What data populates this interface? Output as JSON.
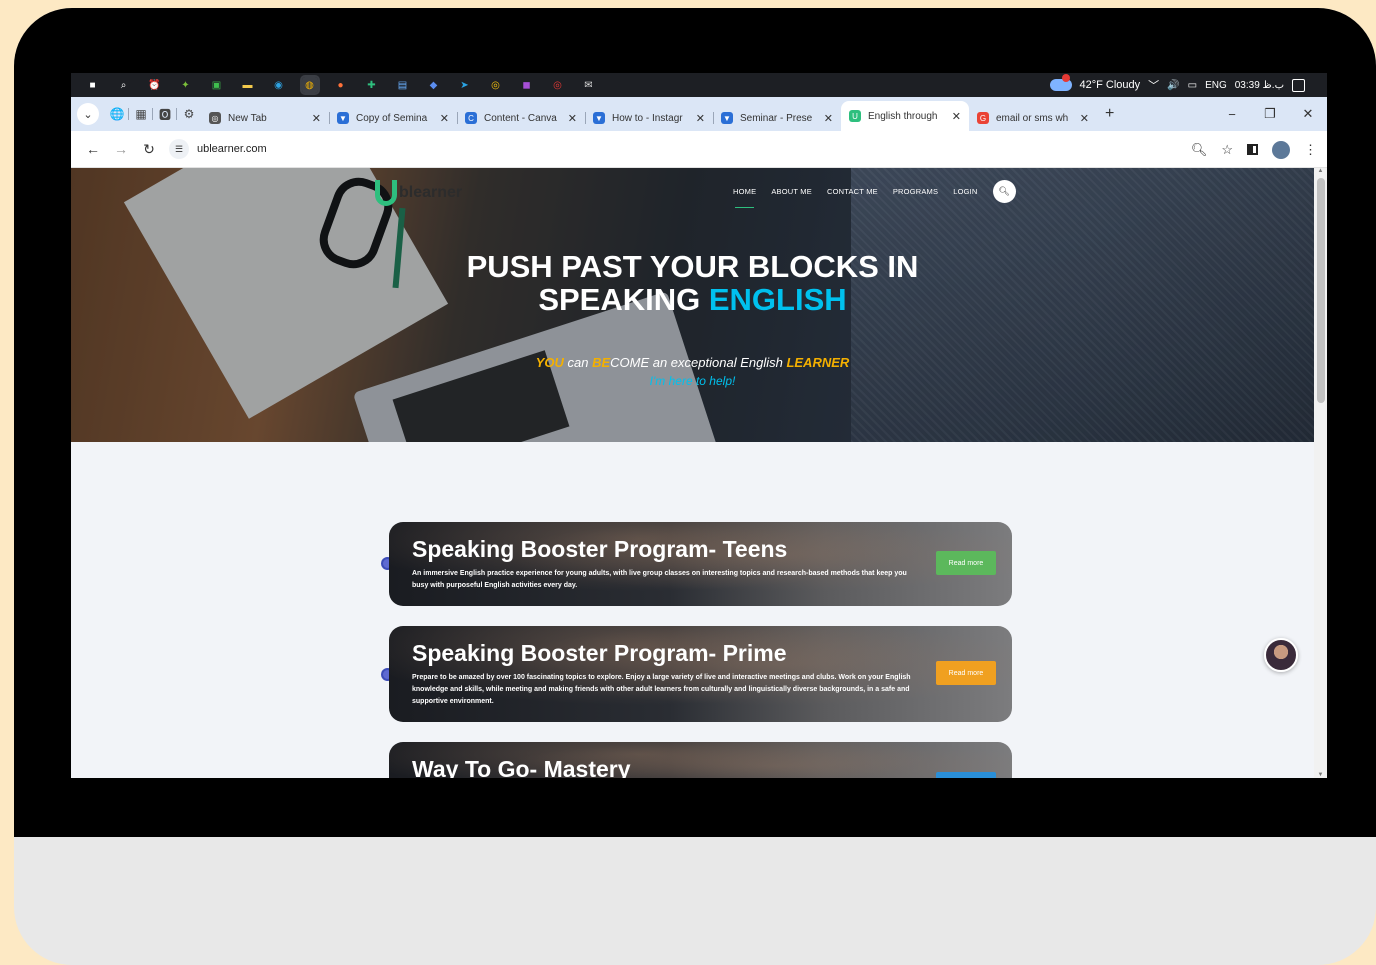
{
  "taskbar": {
    "apps": [
      {
        "name": "windows-start",
        "glyph": "■",
        "color": "#ffffff"
      },
      {
        "name": "search",
        "glyph": "⌕",
        "color": "#ffffff"
      },
      {
        "name": "alarm",
        "glyph": "⏰",
        "color": "#ffffff"
      },
      {
        "name": "app-green-1",
        "glyph": "✦",
        "color": "#7bbf3a"
      },
      {
        "name": "app-green-2",
        "glyph": "▣",
        "color": "#3fbf4e"
      },
      {
        "name": "file-explorer",
        "glyph": "▬",
        "color": "#f2c94c"
      },
      {
        "name": "edge",
        "glyph": "◉",
        "color": "#2ea3e3"
      },
      {
        "name": "chrome",
        "glyph": "◍",
        "color": "#f4b400"
      },
      {
        "name": "firefox",
        "glyph": "●",
        "color": "#ff7139"
      },
      {
        "name": "app-multi",
        "glyph": "✚",
        "color": "#2ebf7e"
      },
      {
        "name": "remote-desktop",
        "glyph": "▤",
        "color": "#6ab0ff"
      },
      {
        "name": "app-blue",
        "glyph": "◆",
        "color": "#5b8def"
      },
      {
        "name": "telegram",
        "glyph": "➤",
        "color": "#2aa3e3"
      },
      {
        "name": "app-yellow",
        "glyph": "◎",
        "color": "#f4c20d"
      },
      {
        "name": "app-purple",
        "glyph": "◼",
        "color": "#a64fd6"
      },
      {
        "name": "app-red",
        "glyph": "◎",
        "color": "#e53935"
      },
      {
        "name": "app-mail",
        "glyph": "✉",
        "color": "#dddddd"
      }
    ],
    "tray": {
      "weather": "42°F  Cloudy",
      "chevron": "﹀",
      "volume": "🔊",
      "language": "ENG",
      "clock": "03:39 ب.ظ"
    }
  },
  "browser": {
    "pinned": [
      "🌐",
      "▦",
      "🅾",
      "⚙"
    ],
    "tabs": [
      {
        "title": "New Tab",
        "fav": "◎",
        "favColor": "#555555",
        "active": false
      },
      {
        "title": "Copy of Semina",
        "fav": "▼",
        "favColor": "#2b6fd6",
        "active": false
      },
      {
        "title": "Content - Canva",
        "fav": "C",
        "favColor": "#2b6fd6",
        "active": false
      },
      {
        "title": "How to - Instagr",
        "fav": "▼",
        "favColor": "#2b6fd6",
        "active": false
      },
      {
        "title": "Seminar - Prese",
        "fav": "▼",
        "favColor": "#2b6fd6",
        "active": false
      },
      {
        "title": "English through",
        "fav": "U",
        "favColor": "#2ebf7e",
        "active": true
      },
      {
        "title": "email or sms wh",
        "fav": "G",
        "favColor": "#ea4335",
        "active": false
      }
    ],
    "new_tab": "+",
    "window_controls": {
      "minimize": "−",
      "restore": "❐",
      "close": "✕"
    },
    "url": "ublearner.com"
  },
  "site": {
    "logo": "blearner",
    "menu": [
      "HOME",
      "ABOUT ME",
      "CONTACT ME",
      "PROGRAMS",
      "LOGIN"
    ],
    "headline_line1": "PUSH PAST YOUR BLOCKS IN",
    "headline_line2_a": "SPEAKING ",
    "headline_line2_b": "ENGLISH",
    "tagline": {
      "you": "YOU",
      "can": " can ",
      "be": "BE",
      "come": "COME an exceptional English ",
      "learner": "LEARNER"
    },
    "help": "I'm here to help!",
    "colors": {
      "accent": "#00c1ee",
      "yellow": "#f4b000",
      "green": "#2ebf7e"
    },
    "programs": [
      {
        "title": "Speaking Booster Program- Teens",
        "description": "An immersive English practice experience for young adults, with live group classes on interesting topics and research-based methods that keep you busy with purposeful English activities every day.",
        "button": "Read more",
        "buttonColor": "#5cb85c"
      },
      {
        "title": "Speaking Booster Program- Prime",
        "description": "Prepare to be amazed by over 100 fascinating topics to explore. Enjoy a large variety of live and interactive meetings and clubs. Work on your English knowledge and skills, while meeting and making friends with other adult learners from culturally and linguistically diverse backgrounds, in a safe and supportive environment.",
        "button": "Read more",
        "buttonColor": "#f0a020"
      },
      {
        "title": "Way To Go- Mastery",
        "description": "",
        "button": "",
        "buttonColor": "#2a8fd8"
      }
    ]
  }
}
